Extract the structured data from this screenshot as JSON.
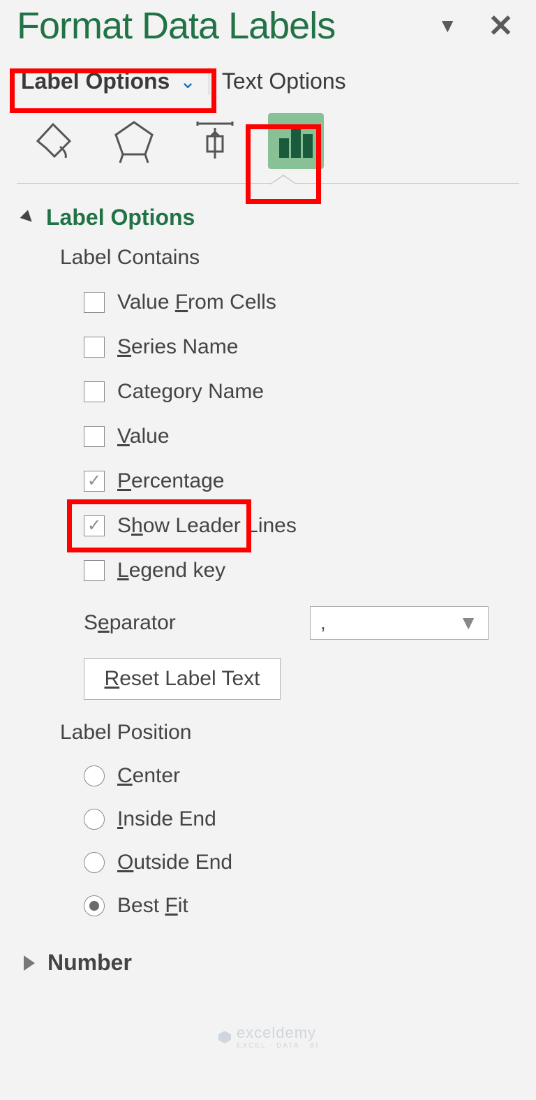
{
  "header": {
    "title": "Format Data Labels"
  },
  "tabs": {
    "label_options": "Label Options",
    "text_options": "Text Options"
  },
  "section": {
    "label_options_title": "Label Options",
    "label_contains": "Label Contains",
    "label_position": "Label Position",
    "number": "Number"
  },
  "checks": {
    "value_from_cells_pre": "Value ",
    "value_from_cells_u": "F",
    "value_from_cells_post": "rom Cells",
    "series_u": "S",
    "series_post": "eries Name",
    "category_pre": "Cate",
    "category_u": "g",
    "category_post": "ory Name",
    "value_u": "V",
    "value_post": "alue",
    "percentage_u": "P",
    "percentage_post": "ercentage",
    "leader_pre": "S",
    "leader_u": "h",
    "leader_post": "ow Leader Lines",
    "legend_u": "L",
    "legend_post": "egend key"
  },
  "separator": {
    "label_pre": "S",
    "label_u": "e",
    "label_post": "parator",
    "value": ","
  },
  "reset": {
    "u": "R",
    "post": "eset Label Text"
  },
  "radios": {
    "center_u": "C",
    "center_post": "enter",
    "inside_u": "I",
    "inside_post": "nside End",
    "outside_u": "O",
    "outside_post": "utside End",
    "best_pre": "Best ",
    "best_u": "F",
    "best_post": "it"
  },
  "watermark": {
    "main": "exceldemy",
    "sub": "EXCEL · DATA · BI"
  }
}
